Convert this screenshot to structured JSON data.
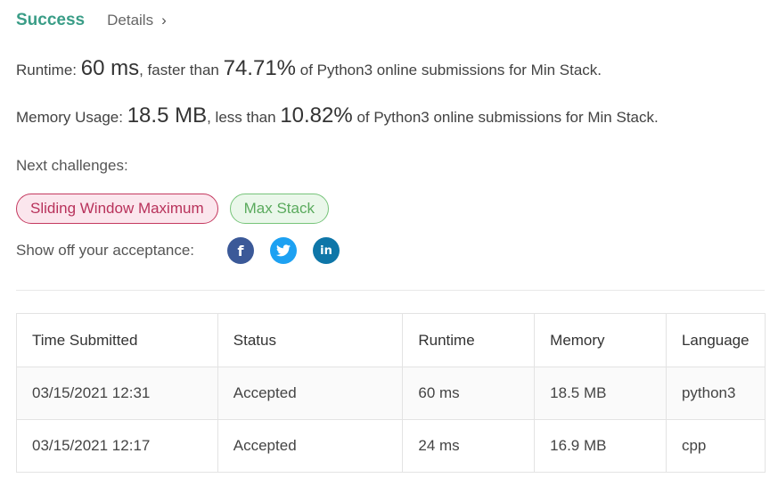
{
  "header": {
    "status": "Success",
    "details_label": "Details",
    "chevron": "›"
  },
  "runtime": {
    "label": "Runtime: ",
    "value": "60 ms",
    "mid": ", faster than ",
    "percent": "74.71%",
    "suffix": " of Python3 online submissions for Min Stack."
  },
  "memory": {
    "label": "Memory Usage: ",
    "value": "18.5 MB",
    "mid": ", less than ",
    "percent": "10.82%",
    "suffix": " of Python3 online submissions for Min Stack."
  },
  "next_challenges": {
    "label": "Next challenges:",
    "items": [
      {
        "title": "Sliding Window Maximum",
        "difficulty_color": "#c4395f"
      },
      {
        "title": "Max Stack",
        "difficulty_color": "#77c47a"
      }
    ]
  },
  "share": {
    "label": "Show off your acceptance:",
    "icons": [
      {
        "name": "facebook-icon",
        "glyph": "f",
        "color": "#3b5998"
      },
      {
        "name": "twitter-icon",
        "glyph": "🐦",
        "color": "#1da1f2"
      },
      {
        "name": "linkedin-icon",
        "glyph": "in",
        "color": "#0e76a8"
      }
    ]
  },
  "table": {
    "headers": [
      "Time Submitted",
      "Status",
      "Runtime",
      "Memory",
      "Language"
    ],
    "rows": [
      [
        "03/15/2021 12:31",
        "Accepted",
        "60 ms",
        "18.5 MB",
        "python3"
      ],
      [
        "03/15/2021 12:17",
        "Accepted",
        "24 ms",
        "16.9 MB",
        "cpp"
      ]
    ]
  },
  "colors": {
    "accent": "#3a9d87",
    "hard": "#c4395f",
    "medium": "#5aaa5d"
  }
}
